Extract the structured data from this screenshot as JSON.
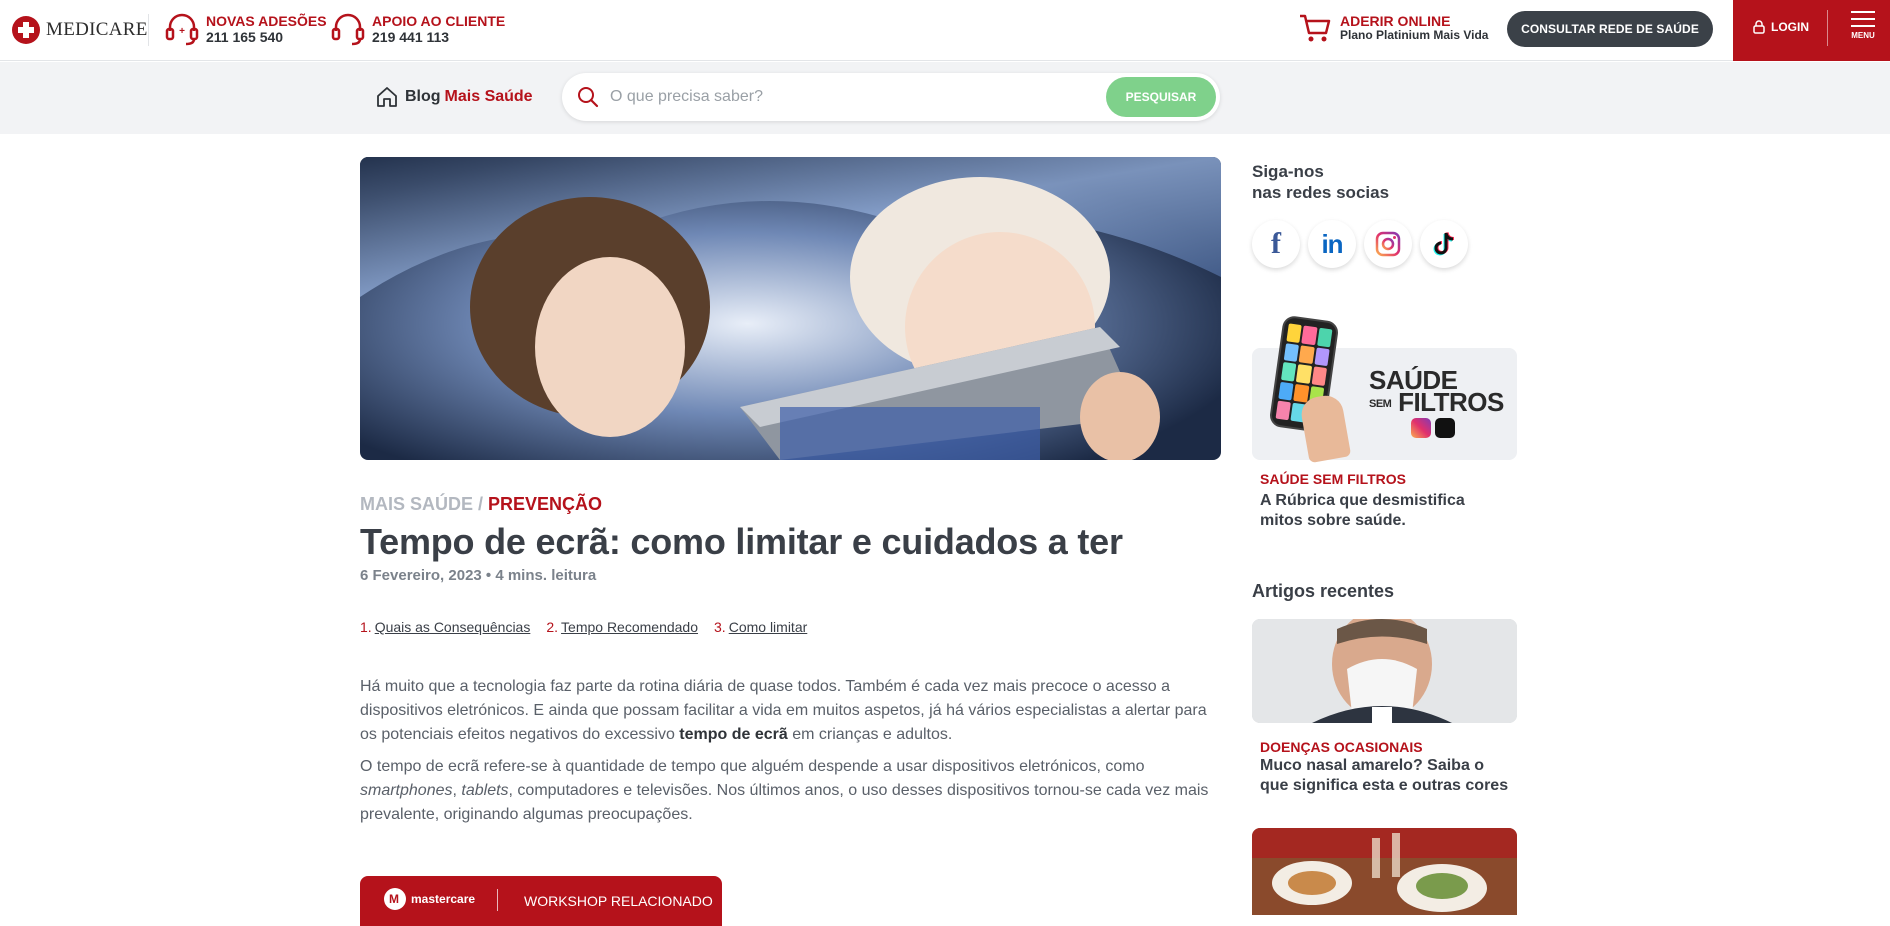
{
  "header": {
    "logo_text": "MEDICARE",
    "novas_adesoes": {
      "label": "NOVAS ADESÕES",
      "phone": "211 165 540"
    },
    "apoio_cliente": {
      "label": "APOIO AO CLIENTE",
      "phone": "219 441 113"
    },
    "aderir": {
      "label": "ADERIR ONLINE",
      "sub": "Plano Platinium Mais Vida"
    },
    "consultar_btn": "CONSULTAR REDE DE SAÚDE",
    "login": "LOGIN",
    "menu": "MENU",
    "colors": {
      "brand_red": "#b5121b",
      "dark": "#3b4148"
    }
  },
  "subbar": {
    "blog": "Blog",
    "blog_accent": "Mais Saúde",
    "search_placeholder": "O que precisa saber?",
    "search_button": "PESQUISAR",
    "search_button_color": "#7fd18b"
  },
  "article": {
    "category_parent": "MAIS SAÚDE /",
    "category": "PREVENÇÃO",
    "title": "Tempo de ecrã: como limitar e cuidados a ter",
    "meta": "6 Fevereiro, 2023 • 4 mins. leitura",
    "toc": [
      {
        "num": "1.",
        "label": "Quais as Consequências"
      },
      {
        "num": "2.",
        "label": "Tempo Recomendado"
      },
      {
        "num": "3.",
        "label": "Como limitar"
      }
    ],
    "p1_a": "Há muito que a tecnologia faz parte da rotina diária de quase todos. Também é cada vez mais precoce o acesso a dispositivos eletrónicos. E ainda que possam facilitar a vida em muitos aspetos, já há vários especialistas a alertar para os potenciais efeitos negativos do excessivo ",
    "p1_bold": "tempo de ecrã",
    "p1_b": " em crianças e adultos.",
    "p2_a": "O tempo de ecrã refere-se à quantidade de tempo que alguém despende a usar dispositivos eletrónicos, como ",
    "p2_i1": "smartphones",
    "p2_sep": ", ",
    "p2_i2": "tablets",
    "p2_b": ", computadores e televisões. Nos últimos anos, o uso desses dispositivos tornou-se cada vez mais prevalente, originando algumas preocupações.",
    "workshop": {
      "brand": "mastercare",
      "label": "WORKSHOP RELACIONADO"
    }
  },
  "sidebar": {
    "follow_line1": "Siga-nos",
    "follow_line2": "nas redes socias",
    "social": [
      {
        "name": "facebook-icon",
        "glyph": "f"
      },
      {
        "name": "linkedin-icon",
        "glyph": "in"
      },
      {
        "name": "instagram-icon",
        "glyph": ""
      },
      {
        "name": "tiktok-icon",
        "glyph": ""
      }
    ],
    "promo": {
      "brand_line1": "SAÚDE",
      "brand_small": "SEM",
      "brand_line2": "FILTROS",
      "category": "SAÚDE SEM FILTROS",
      "title": "A Rúbrica que desmistifica mitos sobre saúde."
    },
    "recent_heading": "Artigos recentes",
    "recent": [
      {
        "category": "DOENÇAS OCASIONAIS",
        "title": "Muco nasal amarelo? Saiba o que significa esta e outras cores"
      }
    ]
  }
}
